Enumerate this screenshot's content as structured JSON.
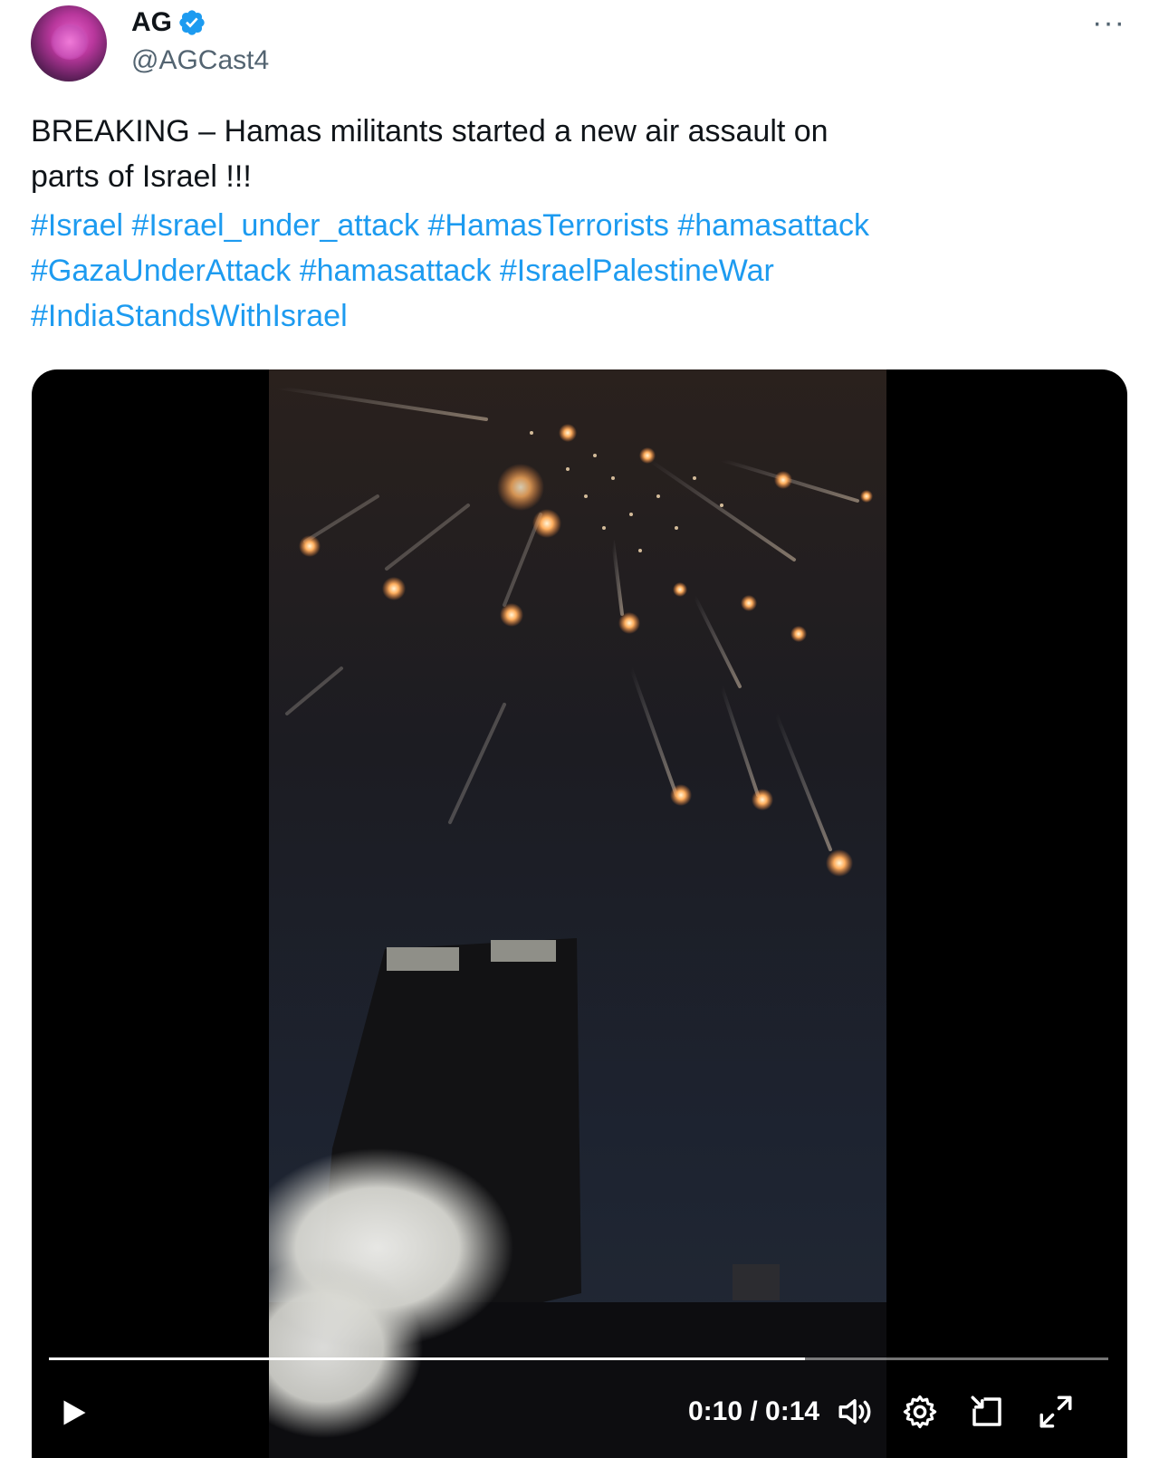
{
  "author": {
    "name": "AG",
    "handle": "@AGCast4",
    "verified": true,
    "verified_color": "#1d9bf0"
  },
  "tweet": {
    "text_lines": [
      "BREAKING – Hamas militants started a new air assault on",
      "parts of Israel !!!"
    ],
    "hashtag_rows": [
      [
        "#Israel",
        "#Israel_under_attack",
        "#HamasTerrorists",
        "#hamasattack"
      ],
      [
        "#GazaUnderAttack",
        "#hamasattack",
        "#IsraelPalestineWar"
      ],
      [
        "#IndiaStandsWithIsrael"
      ]
    ],
    "link_color": "#1d9bf0"
  },
  "menu": {
    "more_label": "···"
  },
  "video": {
    "current_time": "0:10",
    "duration": "0:14",
    "time_display": "0:10 / 0:14",
    "progress": 0.714,
    "controls": [
      "play-icon",
      "volume-icon",
      "settings-icon",
      "picture-in-picture-icon",
      "fullscreen-icon"
    ]
  }
}
